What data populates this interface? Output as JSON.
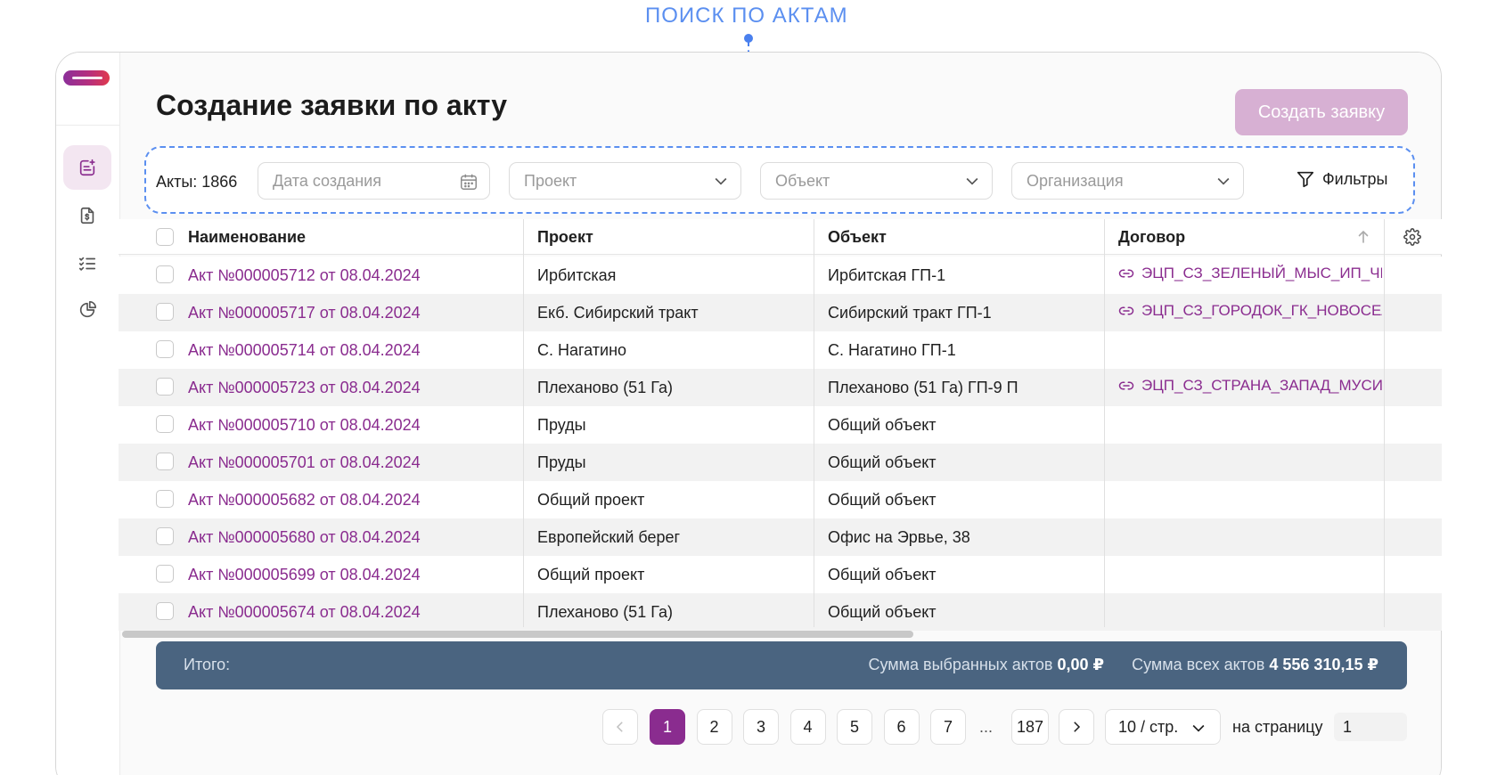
{
  "annotation": {
    "label": "ПОИСК ПО АКТАМ"
  },
  "header": {
    "title": "Создание заявки по акту",
    "create_button": "Создать заявку"
  },
  "sidebar": {
    "items": [
      {
        "icon": "new-request-icon",
        "active": true
      },
      {
        "icon": "payment-document-icon",
        "active": false
      },
      {
        "icon": "checklist-icon",
        "active": false
      },
      {
        "icon": "analytics-pie-icon",
        "active": false
      }
    ]
  },
  "filters": {
    "count_label": "Акты: 1866",
    "date_placeholder": "Дата создания",
    "project_placeholder": "Проект",
    "object_placeholder": "Объект",
    "organization_placeholder": "Организация",
    "filters_button": "Фильтры"
  },
  "table": {
    "columns": [
      "Наименование",
      "Проект",
      "Объект",
      "Договор"
    ],
    "rows": [
      {
        "name": "Акт №000005712 от 08.04.2024",
        "project": "Ирбитская",
        "object": "Ирбитская ГП-1",
        "contract": "ЭЦП_СЗ_ЗЕЛЕНЫЙ_МЫС_ИП_ЧЕ"
      },
      {
        "name": "Акт №000005717 от 08.04.2024",
        "project": "Екб. Сибирский тракт",
        "object": "Сибирский тракт ГП-1",
        "contract": "ЭЦП_СЗ_ГОРОДОК_ГК_НОВОСЕЛ"
      },
      {
        "name": "Акт №000005714 от 08.04.2024",
        "project": "С. Нагатино",
        "object": "С. Нагатино ГП-1",
        "contract": ""
      },
      {
        "name": "Акт №000005723 от 08.04.2024",
        "project": "Плеханово (51 Га)",
        "object": "Плеханово (51 Га) ГП-9 П",
        "contract": "ЭЦП_СЗ_СТРАНА_ЗАПАД_МУСИ"
      },
      {
        "name": "Акт №000005710 от 08.04.2024",
        "project": "Пруды",
        "object": "Общий объект",
        "contract": ""
      },
      {
        "name": "Акт №000005701 от 08.04.2024",
        "project": "Пруды",
        "object": "Общий объект",
        "contract": ""
      },
      {
        "name": "Акт №000005682 от 08.04.2024",
        "project": "Общий проект",
        "object": "Общий объект",
        "contract": ""
      },
      {
        "name": "Акт №000005680 от 08.04.2024",
        "project": "Европейский берег",
        "object": "Офис на Эрвье, 38",
        "contract": ""
      },
      {
        "name": "Акт №000005699 от 08.04.2024",
        "project": "Общий проект",
        "object": "Общий объект",
        "contract": ""
      },
      {
        "name": "Акт №000005674 от 08.04.2024",
        "project": "Плеханово (51 Га)",
        "object": "Общий объект",
        "contract": ""
      }
    ]
  },
  "totals": {
    "label": "Итого:",
    "selected_label": "Сумма выбранных актов",
    "selected_value": "0,00 ₽",
    "all_label": "Сумма всех актов",
    "all_value": "4 556 310,15 ₽"
  },
  "pagination": {
    "pages": [
      "1",
      "2",
      "3",
      "4",
      "5",
      "6",
      "7"
    ],
    "ellipsis": "...",
    "last_page": "187",
    "current": "1",
    "per_page": "10 / стр.",
    "goto_label": "на страницу",
    "goto_value": "1"
  },
  "colors": {
    "accent": "#8a2c8f",
    "annotation": "#4a80ee",
    "totals_bg": "#4a6480",
    "create_button_bg": "#d7b0d3"
  }
}
